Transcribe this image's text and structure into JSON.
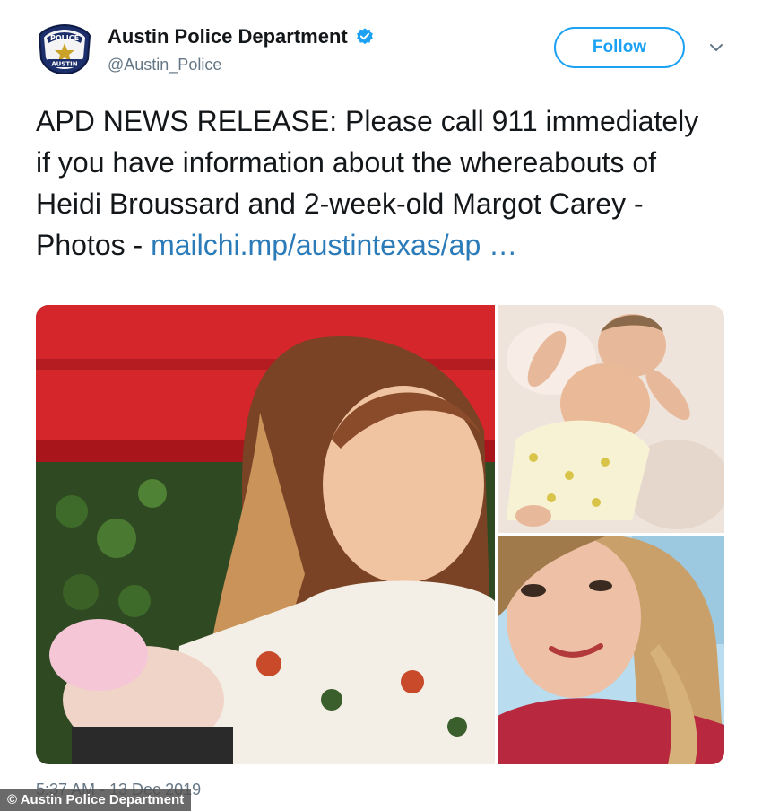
{
  "account": {
    "display_name": "Austin Police Department",
    "handle": "@Austin_Police",
    "avatar_icon": "police-badge-icon",
    "badge_text_top": "POLICE",
    "badge_text_bottom": "AUSTIN",
    "verified_icon": "verified-badge-icon"
  },
  "actions": {
    "follow_label": "Follow",
    "menu_icon": "chevron-down-icon"
  },
  "tweet": {
    "text": "APD NEWS RELEASE: Please call 911 immediately if you have information about the whereabouts of Heidi Broussard and 2-week-old Margot Carey - Photos - ",
    "link_text": "mailchi.mp/austintexas/ap …",
    "timestamp": "5:37 AM - 13 Dec 2019"
  },
  "watermark": "© Austin Police Department",
  "colors": {
    "accent": "#1da1f2",
    "link": "#2b7bb9",
    "text": "#14171a",
    "secondary": "#657786"
  }
}
